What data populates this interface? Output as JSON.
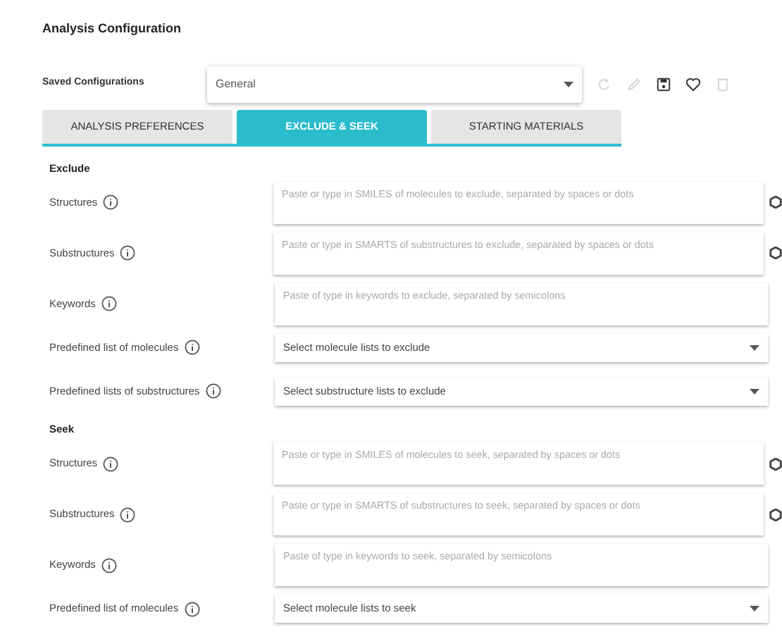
{
  "title": "Analysis Configuration",
  "saved_configurations": {
    "label": "Saved Configurations",
    "value": "General"
  },
  "toolbar": [
    {
      "kind": "refresh",
      "disabled": true
    },
    {
      "kind": "edit",
      "disabled": true
    },
    {
      "kind": "save",
      "disabled": false
    },
    {
      "kind": "favorite",
      "disabled": false
    },
    {
      "kind": "delete",
      "disabled": true
    }
  ],
  "tabs": [
    {
      "label": "ANALYSIS PREFERENCES",
      "selected": false
    },
    {
      "label": "EXCLUDE & SEEK",
      "selected": true
    },
    {
      "label": "STARTING MATERIALS",
      "selected": false
    }
  ],
  "sections": [
    {
      "heading": "Exclude",
      "fields": [
        {
          "kind": "editor",
          "label": "Structures",
          "placeholder": "Paste or type in SMILES of molecules to exclude, separated by spaces or dots"
        },
        {
          "kind": "editor",
          "label": "Substructures",
          "placeholder": "Paste or type in SMARTS of substructures to exclude, separated by spaces or dots"
        },
        {
          "kind": "text",
          "label": "Keywords",
          "placeholder": "Paste of type in keywords to exclude, separated by semicolons"
        },
        {
          "kind": "select",
          "label": "Predefined list of molecules",
          "placeholder": "Select molecule lists to exclude"
        },
        {
          "kind": "select",
          "label": "Predefined lists of substructures",
          "placeholder": "Select substructure lists to exclude"
        }
      ]
    },
    {
      "heading": "Seek",
      "fields": [
        {
          "kind": "editor",
          "label": "Structures",
          "placeholder": "Paste or type in SMILES of molecules to seek, separated by spaces or dots"
        },
        {
          "kind": "editor",
          "label": "Substructures",
          "placeholder": "Paste or type in SMARTS of substructures to seek, separated by spaces or dots"
        },
        {
          "kind": "text",
          "label": "Keywords",
          "placeholder": "Paste of type in keywords to seek, separated by semicolons"
        },
        {
          "kind": "select",
          "label": "Predefined list of molecules",
          "placeholder": "Select molecule lists to seek"
        }
      ]
    }
  ]
}
